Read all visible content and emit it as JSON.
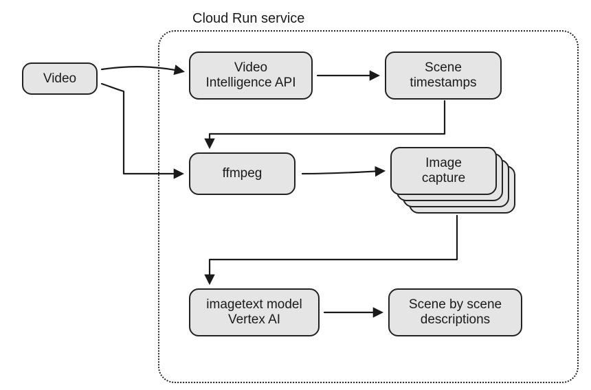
{
  "diagram": {
    "container_label": "Cloud Run service",
    "nodes": {
      "video": "Video",
      "video_intel": "Video\nIntelligence API",
      "scene_ts": "Scene\ntimestamps",
      "ffmpeg": "ffmpeg",
      "image_capture": "Image\ncapture",
      "imagetext": "imagetext model\nVertex AI",
      "scene_desc": "Scene by scene\ndescriptions"
    },
    "edges": [
      {
        "from": "video",
        "to": "video_intel"
      },
      {
        "from": "video_intel",
        "to": "scene_ts"
      },
      {
        "from": "scene_ts",
        "to": "ffmpeg"
      },
      {
        "from": "video",
        "to": "ffmpeg"
      },
      {
        "from": "ffmpeg",
        "to": "image_capture"
      },
      {
        "from": "image_capture",
        "to": "imagetext"
      },
      {
        "from": "imagetext",
        "to": "scene_desc"
      }
    ]
  }
}
